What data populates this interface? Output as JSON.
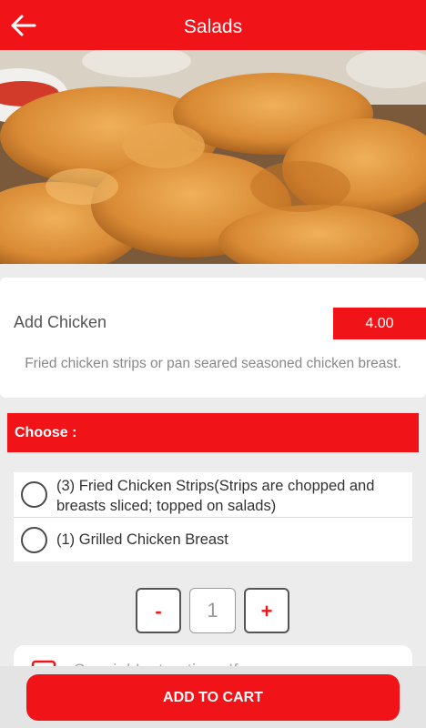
{
  "header": {
    "title": "Salads"
  },
  "item": {
    "name": "Add Chicken",
    "price": "4.00",
    "description": "Fried chicken strips or pan seared seasoned chicken breast."
  },
  "choose": {
    "label": "Choose :",
    "options": [
      "(3) Fried Chicken Strips(Strips are chopped and breasts sliced; topped on salads)",
      "(1) Grilled Chicken Breast"
    ]
  },
  "quantity": {
    "minus": "-",
    "value": "1",
    "plus": "+"
  },
  "instructions": {
    "text": "Special Instructions If any"
  },
  "cart": {
    "label": "ADD TO CART"
  },
  "colors": {
    "accent": "#f01418",
    "background": "#ececec"
  },
  "icons": {
    "back": "arrow-left-icon",
    "note": "note-icon"
  }
}
